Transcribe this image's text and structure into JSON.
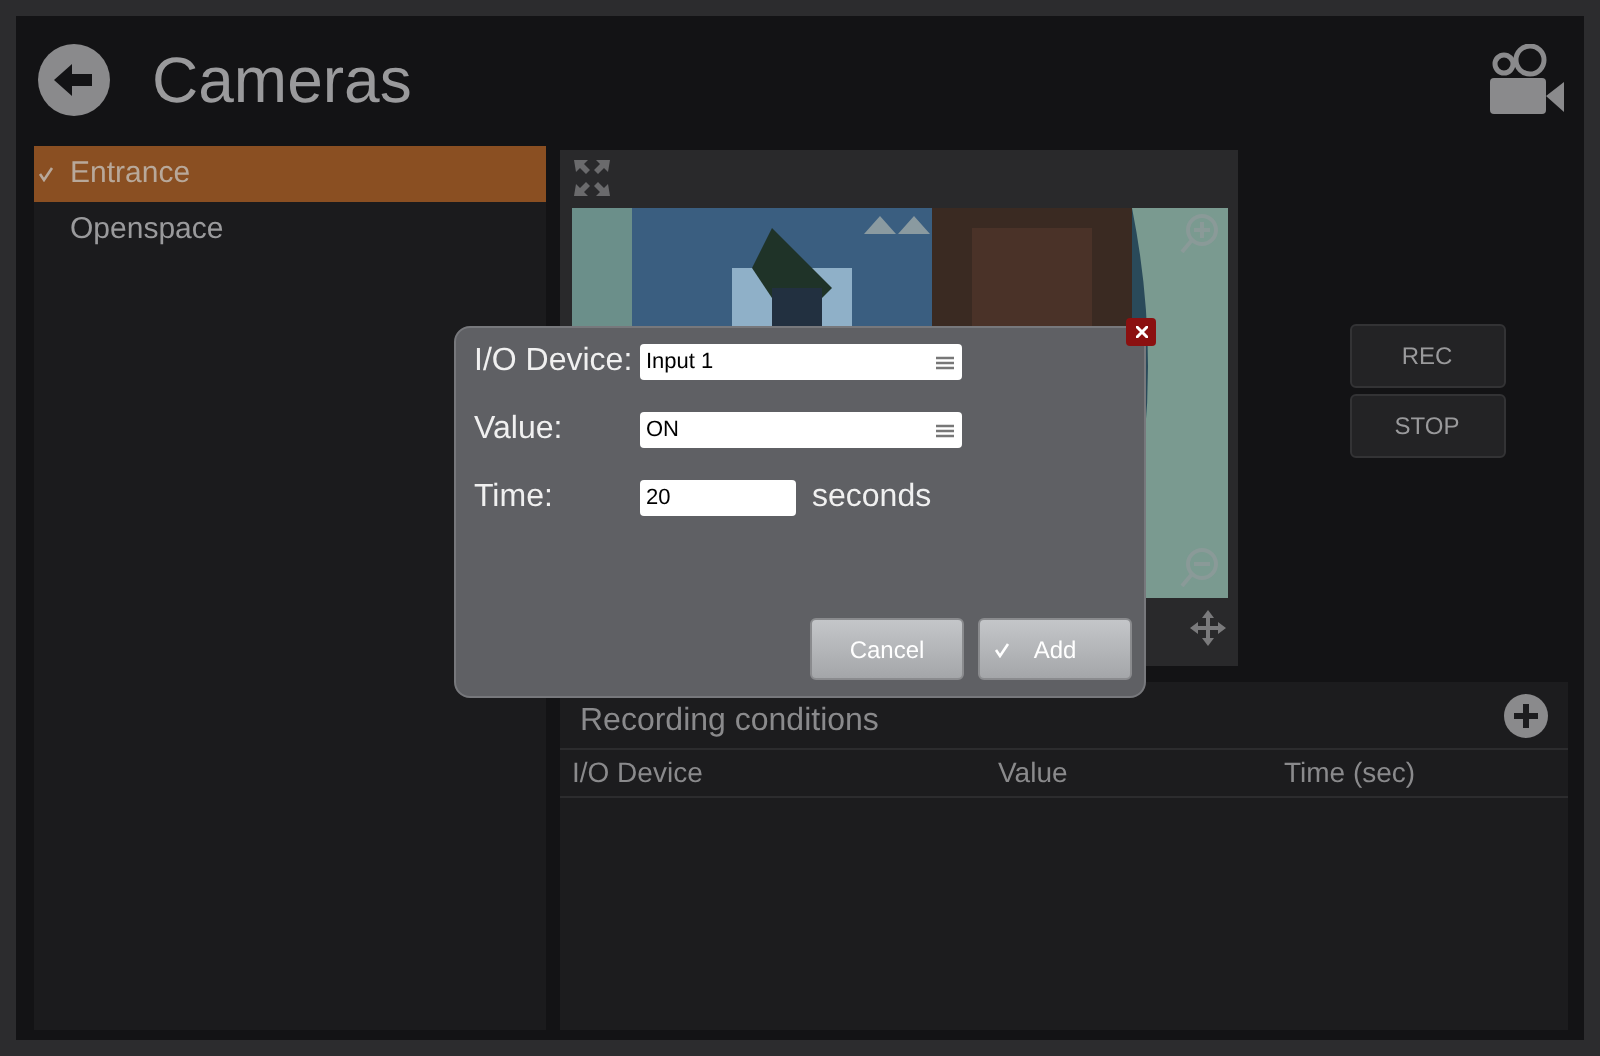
{
  "header": {
    "title": "Cameras"
  },
  "cameras": [
    {
      "name": "Entrance",
      "selected": true
    },
    {
      "name": "Openspace",
      "selected": false
    }
  ],
  "controls": [
    "REC",
    "STOP"
  ],
  "conditions": {
    "title": "Recording conditions",
    "columns": [
      "I/O Device",
      "Value",
      "Time (sec)"
    ]
  },
  "dialog": {
    "fields": [
      {
        "label": "I/O Device:",
        "kind": "select",
        "value": "Input 1"
      },
      {
        "label": "Value:",
        "kind": "select",
        "value": "ON"
      },
      {
        "label": "Time:",
        "kind": "text",
        "value": "20",
        "unit": "seconds"
      }
    ],
    "buttons": [
      {
        "label": "Cancel",
        "kind": "cancel"
      },
      {
        "label": "Add",
        "kind": "confirm"
      }
    ]
  }
}
